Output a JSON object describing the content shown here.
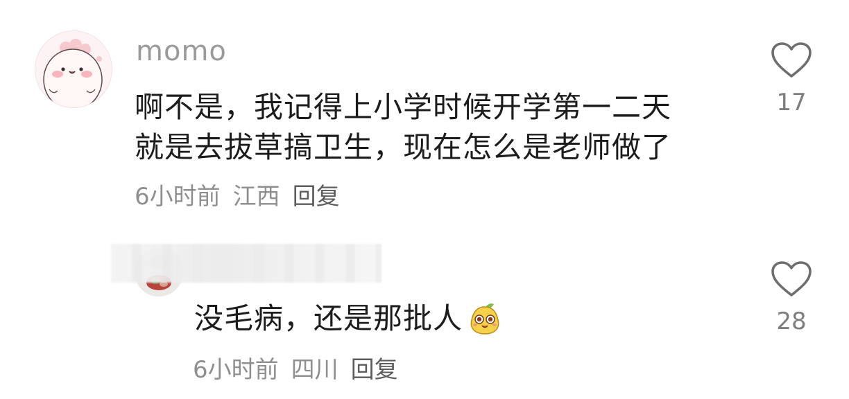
{
  "comment": {
    "username": "momo",
    "text_line1": "啊不是，我记得上小学时候开学第一二天",
    "text_line2": "就是去拔草搞卫生，现在怎么是老师做了",
    "time": "6小时前",
    "location": "江西",
    "reply_label": "回复",
    "likes": "17",
    "avatar_icon": "cartoon-pink-creature-avatar"
  },
  "reply": {
    "text": "没毛病，还是那批人",
    "emoji_icon": "yellow-pear-smiling-emoji",
    "time": "6小时前",
    "location": "四川",
    "reply_label": "回复",
    "likes": "28",
    "avatar_icon": "photo-avatar-blurred"
  },
  "colors": {
    "primary_text": "#1c1c1c",
    "secondary_text": "#8f8f8f",
    "username": "#9a9a9a",
    "heart_outline": "#6e6e6e"
  }
}
